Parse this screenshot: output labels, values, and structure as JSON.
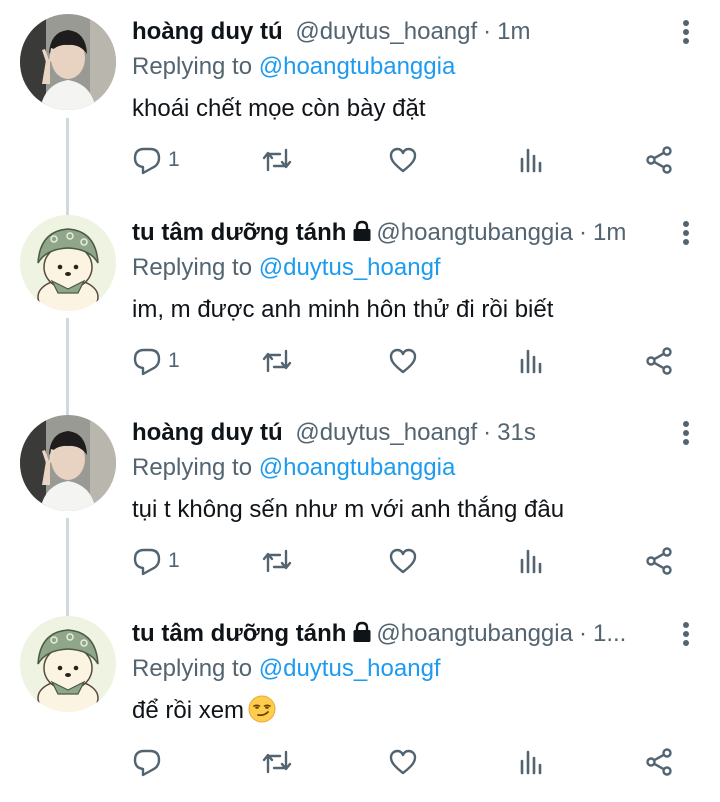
{
  "tweets": [
    {
      "name": "hoàng duy tú",
      "handle": "@duytus_hoangf",
      "separator": "·",
      "time": "1m",
      "locked": false,
      "avatar": "photo-avatar",
      "reply_prefix": "Replying to ",
      "reply_to": "@hoangtubanggia",
      "text": "khoái chết mọe còn bày đặt",
      "emoji": "",
      "reply_count": "1"
    },
    {
      "name": "tu tâm dưỡng tánh",
      "handle": "@hoangtubanggia",
      "separator": "·",
      "time": "1m",
      "locked": true,
      "avatar": "bear-avatar",
      "reply_prefix": "Replying to ",
      "reply_to": "@duytus_hoangf",
      "text": "im, m được anh minh hôn thử đi rồi biết",
      "emoji": "",
      "reply_count": "1"
    },
    {
      "name": "hoàng duy tú",
      "handle": "@duytus_hoangf",
      "separator": "·",
      "time": "31s",
      "locked": false,
      "avatar": "photo-avatar",
      "reply_prefix": "Replying to ",
      "reply_to": "@hoangtubanggia",
      "text": "tụi t không sến như m với anh thắng đâu",
      "emoji": "",
      "reply_count": "1"
    },
    {
      "name": "tu tâm dưỡng tánh",
      "handle": "@hoangtubanggia",
      "separator": "·",
      "time": "1...",
      "locked": true,
      "avatar": "bear-avatar",
      "reply_prefix": "Replying to ",
      "reply_to": "@duytus_hoangf",
      "text": "để rồi xem",
      "emoji": "smirking-face-emoji",
      "reply_count": ""
    }
  ],
  "icons": {
    "reply": "reply-icon",
    "retweet": "retweet-icon",
    "like": "heart-icon",
    "views": "analytics-icon",
    "share": "share-icon",
    "more": "more-vertical-icon",
    "lock": "lock-icon"
  },
  "colors": {
    "text": "#0f1419",
    "secondary": "#536471",
    "link": "#1d9bf0",
    "thread_line": "#cfd9de"
  }
}
